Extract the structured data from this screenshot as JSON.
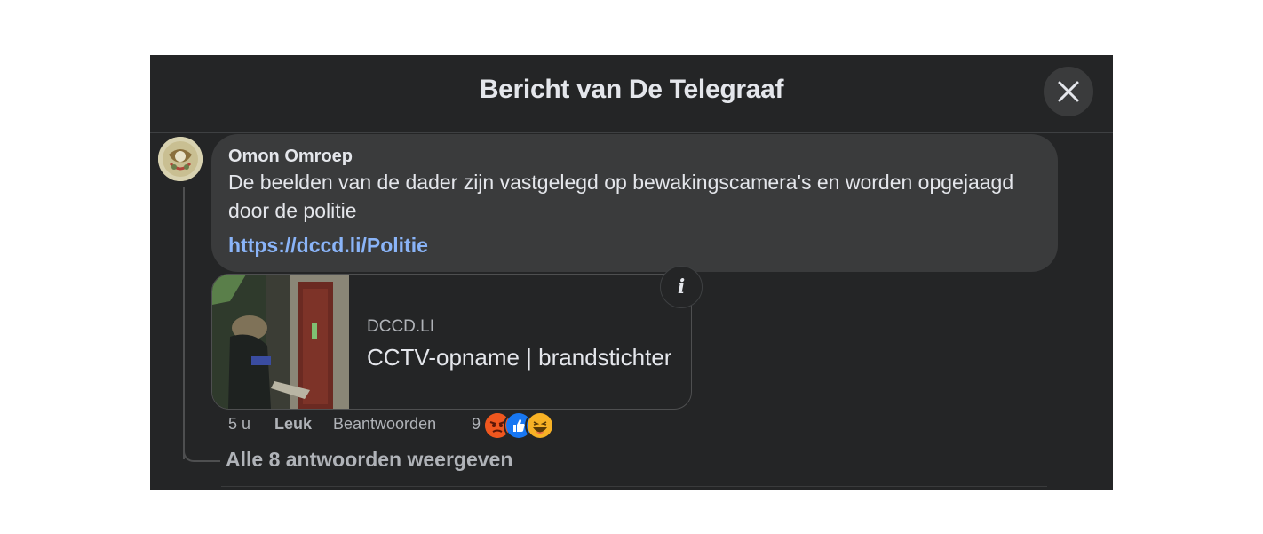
{
  "dialog": {
    "title": "Bericht van De Telegraaf",
    "close_icon": "close-icon"
  },
  "comment": {
    "author": "Omon Omroep",
    "text": "De beelden van de dader zijn vastgelegd op bewakingscamera's en worden opgejaagd door de politie",
    "link": "https://dccd.li/Politie",
    "link_preview": {
      "domain": "DCCD.LI",
      "title": "CCTV-opname | brandstichter",
      "info_icon": "info-icon"
    },
    "actions": {
      "time": "5 u",
      "like": "Leuk",
      "reply": "Beantwoorden",
      "reaction_count": "9",
      "reactions": [
        "angry-reaction-icon",
        "like-reaction-icon",
        "haha-reaction-icon"
      ]
    },
    "more_replies": "Alle 8 antwoorden weergeven"
  },
  "colors": {
    "dialog_bg": "#242526",
    "bubble_bg": "#3a3b3c",
    "text_primary": "#e4e6eb",
    "text_secondary": "#b0b3b8",
    "link": "#8ab4f8",
    "like_blue": "#1877f2"
  }
}
